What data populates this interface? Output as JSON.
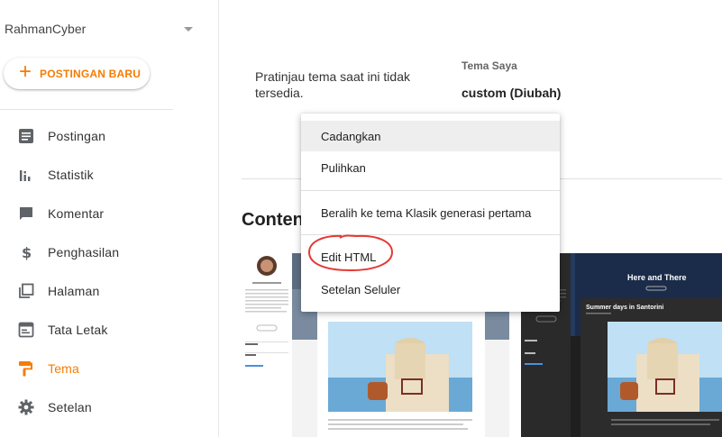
{
  "sidebar": {
    "blog_name": "RahmanCyber",
    "new_post_label": "POSTINGAN BARU",
    "items": [
      {
        "label": "Postingan",
        "icon": "document-icon"
      },
      {
        "label": "Statistik",
        "icon": "bar-chart-icon"
      },
      {
        "label": "Komentar",
        "icon": "comment-icon"
      },
      {
        "label": "Penghasilan",
        "icon": "dollar-icon"
      },
      {
        "label": "Halaman",
        "icon": "pages-icon"
      },
      {
        "label": "Tata Letak",
        "icon": "layout-icon"
      },
      {
        "label": "Tema",
        "icon": "paint-roller-icon",
        "active": true
      },
      {
        "label": "Setelan",
        "icon": "gear-icon"
      }
    ]
  },
  "main": {
    "preview_unavailable": "Pratinjau tema saat ini tidak tersedia.",
    "my_theme_header": "Tema Saya",
    "my_theme_name": "custom (Diubah)",
    "section_title": "Conten"
  },
  "menu": {
    "items": [
      "Cadangkan",
      "Pulihkan",
      "Beralih ke tema Klasik generasi pertama",
      "Edit HTML",
      "Setelan Seluler"
    ]
  },
  "thumbnails": {
    "second_title": "Here and There",
    "second_post_title": "Summer days in Santorini"
  },
  "colors": {
    "accent": "#f57c00",
    "annotation": "#e53935",
    "menu_hover": "#eeeeee"
  }
}
